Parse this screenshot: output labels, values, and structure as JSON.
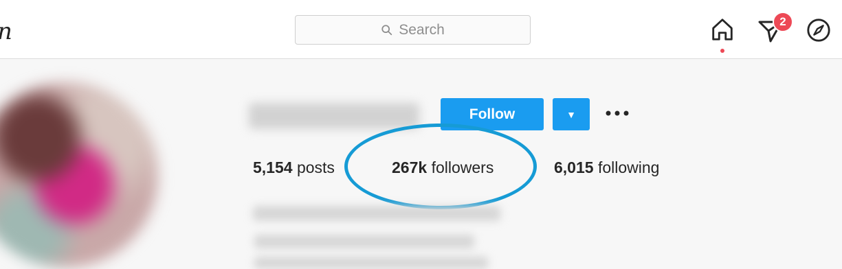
{
  "header": {
    "logo_fragment": "n",
    "search": {
      "placeholder": "Search"
    },
    "direct_badge": "2"
  },
  "profile": {
    "follow_label": "Follow",
    "stats": {
      "posts_count": "5,154",
      "posts_label": "posts",
      "followers_count": "267k",
      "followers_label": "followers",
      "following_count": "6,015",
      "following_label": "following"
    }
  },
  "colors": {
    "accent": "#1a9cf0",
    "badge": "#ed4956",
    "highlight_circle": "#169bd5"
  },
  "icons": [
    "search-icon",
    "home-icon",
    "direct-icon",
    "compass-icon",
    "chevron-down-icon",
    "more-icon"
  ]
}
